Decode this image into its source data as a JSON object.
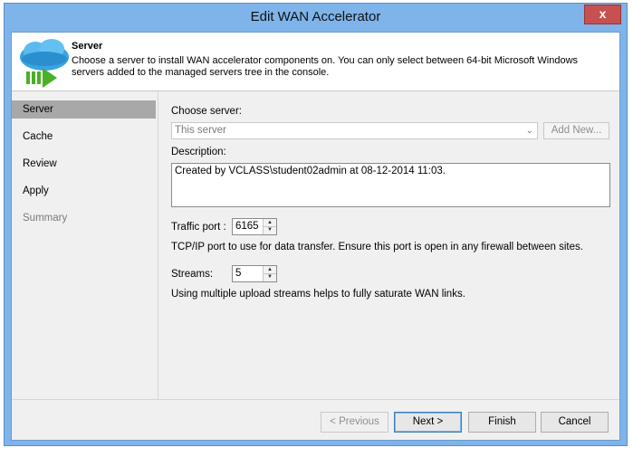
{
  "window": {
    "title": "Edit WAN Accelerator",
    "close_label": "x"
  },
  "header": {
    "title": "Server",
    "description": "Choose a server to install WAN accelerator components on. You can only select between 64-bit Microsoft Windows servers added to the managed servers tree in the console."
  },
  "nav": {
    "items": [
      {
        "label": "Server",
        "state": "selected"
      },
      {
        "label": "Cache",
        "state": "normal"
      },
      {
        "label": "Review",
        "state": "normal"
      },
      {
        "label": "Apply",
        "state": "normal"
      },
      {
        "label": "Summary",
        "state": "disabled"
      }
    ]
  },
  "form": {
    "choose_server_label": "Choose server:",
    "server_value": "This server",
    "add_new_label": "Add New...",
    "description_label": "Description:",
    "description_value": "Created by VCLASS\\student02admin at 08-12-2014 11:03.",
    "traffic_port_label": "Traffic port :",
    "traffic_port_value": "6165",
    "traffic_port_hint": "TCP/IP port to use for data transfer. Ensure this port is open in any firewall between sites.",
    "streams_label": "Streams:",
    "streams_value": "5",
    "streams_hint": "Using multiple upload streams helps to fully saturate WAN links."
  },
  "buttons": {
    "previous": "< Previous",
    "next": "Next >",
    "finish": "Finish",
    "cancel": "Cancel"
  },
  "colors": {
    "window_frame": "#7eb4ea",
    "close_button": "#c75050",
    "nav_selected": "#a8a8a8"
  }
}
